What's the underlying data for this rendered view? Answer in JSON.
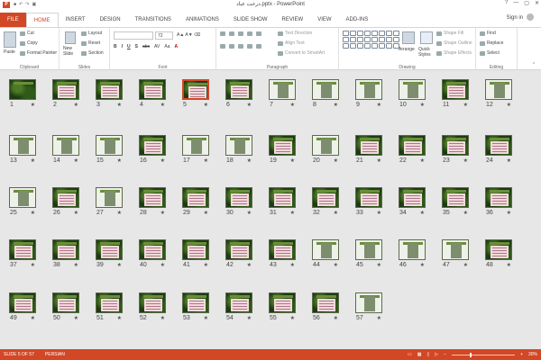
{
  "window": {
    "title": "درخت عباد.pptx - PowerPoint",
    "sign_in": "Sign in",
    "controls": [
      "?",
      "—",
      "▢",
      "✕"
    ]
  },
  "tabs": [
    {
      "label": "FILE",
      "active": false
    },
    {
      "label": "HOME",
      "active": true
    },
    {
      "label": "INSERT",
      "active": false
    },
    {
      "label": "DESIGN",
      "active": false
    },
    {
      "label": "TRANSITIONS",
      "active": false
    },
    {
      "label": "ANIMATIONS",
      "active": false
    },
    {
      "label": "SLIDE SHOW",
      "active": false
    },
    {
      "label": "REVIEW",
      "active": false
    },
    {
      "label": "VIEW",
      "active": false
    },
    {
      "label": "ADD-INS",
      "active": false
    }
  ],
  "ribbon": {
    "clipboard": {
      "label": "Clipboard",
      "paste": "Paste",
      "cut": "Cut",
      "copy": "Copy",
      "format_painter": "Format Painter"
    },
    "slides": {
      "label": "Slides",
      "new_slide": "New Slide",
      "layout": "Layout",
      "reset": "Reset",
      "section": "Section"
    },
    "font": {
      "label": "Font",
      "size": "72",
      "buttons": [
        "B",
        "I",
        "U",
        "S",
        "abc",
        "AV",
        "Aa",
        "A"
      ]
    },
    "paragraph": {
      "label": "Paragraph",
      "text_direction": "Text Direction",
      "align_text": "Align Text",
      "convert_smartart": "Convert to SmartArt"
    },
    "drawing": {
      "label": "Drawing",
      "arrange": "Arrange",
      "quick_styles": "Quick Styles",
      "shape_fill": "Shape Fill",
      "shape_outline": "Shape Outline",
      "shape_effects": "Shape Effects"
    },
    "editing": {
      "label": "Editing",
      "find": "Find",
      "replace": "Replace",
      "select": "Select"
    }
  },
  "slides": [
    {
      "n": "1",
      "kind": "title"
    },
    {
      "n": "2",
      "kind": "text"
    },
    {
      "n": "3",
      "kind": "text"
    },
    {
      "n": "4",
      "kind": "text"
    },
    {
      "n": "5",
      "kind": "text",
      "selected": true
    },
    {
      "n": "6",
      "kind": "text"
    },
    {
      "n": "7",
      "kind": "photo"
    },
    {
      "n": "8",
      "kind": "photo"
    },
    {
      "n": "9",
      "kind": "photo"
    },
    {
      "n": "10",
      "kind": "photo"
    },
    {
      "n": "11",
      "kind": "text"
    },
    {
      "n": "12",
      "kind": "photo"
    },
    {
      "n": "13",
      "kind": "photo"
    },
    {
      "n": "14",
      "kind": "photo"
    },
    {
      "n": "15",
      "kind": "photo"
    },
    {
      "n": "16",
      "kind": "text"
    },
    {
      "n": "17",
      "kind": "photo"
    },
    {
      "n": "18",
      "kind": "photo"
    },
    {
      "n": "19",
      "kind": "text"
    },
    {
      "n": "20",
      "kind": "photo"
    },
    {
      "n": "21",
      "kind": "text"
    },
    {
      "n": "22",
      "kind": "text"
    },
    {
      "n": "23",
      "kind": "text"
    },
    {
      "n": "24",
      "kind": "text"
    },
    {
      "n": "25",
      "kind": "photo"
    },
    {
      "n": "26",
      "kind": "text"
    },
    {
      "n": "27",
      "kind": "photo"
    },
    {
      "n": "28",
      "kind": "text"
    },
    {
      "n": "29",
      "kind": "text"
    },
    {
      "n": "30",
      "kind": "text"
    },
    {
      "n": "31",
      "kind": "text"
    },
    {
      "n": "32",
      "kind": "text"
    },
    {
      "n": "33",
      "kind": "text"
    },
    {
      "n": "34",
      "kind": "text"
    },
    {
      "n": "35",
      "kind": "text"
    },
    {
      "n": "36",
      "kind": "text"
    },
    {
      "n": "37",
      "kind": "text"
    },
    {
      "n": "38",
      "kind": "text"
    },
    {
      "n": "39",
      "kind": "text"
    },
    {
      "n": "40",
      "kind": "text"
    },
    {
      "n": "41",
      "kind": "text"
    },
    {
      "n": "42",
      "kind": "text"
    },
    {
      "n": "43",
      "kind": "text"
    },
    {
      "n": "44",
      "kind": "photo"
    },
    {
      "n": "45",
      "kind": "photo"
    },
    {
      "n": "46",
      "kind": "photo"
    },
    {
      "n": "47",
      "kind": "photo"
    },
    {
      "n": "48",
      "kind": "text"
    },
    {
      "n": "49",
      "kind": "text"
    },
    {
      "n": "50",
      "kind": "text"
    },
    {
      "n": "51",
      "kind": "text"
    },
    {
      "n": "52",
      "kind": "text"
    },
    {
      "n": "53",
      "kind": "text"
    },
    {
      "n": "54",
      "kind": "text"
    },
    {
      "n": "55",
      "kind": "text"
    },
    {
      "n": "56",
      "kind": "text"
    },
    {
      "n": "57",
      "kind": "photo"
    }
  ],
  "status": {
    "slide_info": "SLIDE 5 OF 57",
    "language": "PERSIAN",
    "zoom": "30%",
    "zoom_level": 0.3
  }
}
